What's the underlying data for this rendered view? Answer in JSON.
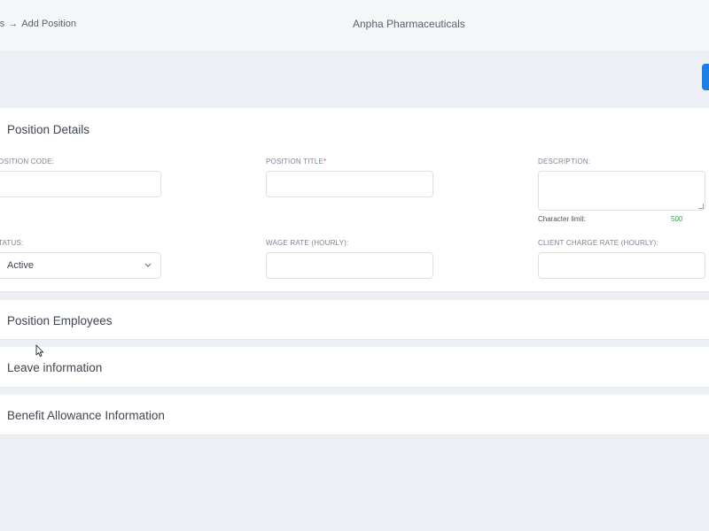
{
  "header": {
    "breadcrumb": {
      "parent": "tions",
      "arrow": "→",
      "current": "Add Position"
    },
    "company": "Anpha Pharmaceuticals"
  },
  "sections": {
    "details": {
      "title": "Position Details",
      "chevron": "⌄",
      "fields": {
        "code": {
          "label": "OSITION CODE:",
          "value": ""
        },
        "title": {
          "label": "POSITION TITLE",
          "required": "*",
          "value": ""
        },
        "description": {
          "label": "DESCRIPTION:",
          "value": ""
        },
        "character_limit_label": "Character limit:",
        "character_limit_value": "500",
        "status": {
          "label": "TATUS:",
          "value": "Active"
        },
        "wage_rate": {
          "label": "WAGE RATE (HOURLY):",
          "value": ""
        },
        "client_charge_rate": {
          "label": "CLIENT CHARGE RATE (HOURLY):",
          "value": ""
        }
      }
    },
    "employees": {
      "title": "Position Employees",
      "chevron": "›"
    },
    "leave": {
      "title": "Leave information",
      "chevron": "›"
    },
    "benefit": {
      "title": "Benefit Allowance Information",
      "chevron": "›"
    }
  },
  "colors": {
    "accent": "#1a7ee6",
    "char_limit_ok": "#36a34a",
    "required": "#e0454a",
    "page_bg": "#eceff3"
  },
  "icons": {
    "chevron_expanded": "chevron-down-icon",
    "chevron_collapsed": "chevron-right-icon",
    "select_arrow": "chevron-down-icon"
  }
}
